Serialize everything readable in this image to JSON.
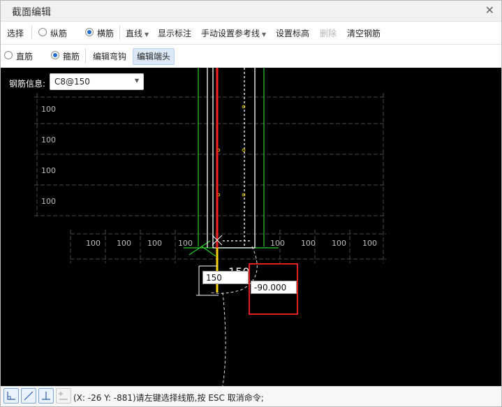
{
  "window": {
    "title": "截面编辑"
  },
  "toolbar1": {
    "select": "选择",
    "longitudinal": "纵筋",
    "transverse": "横筋",
    "line_tool": "直线",
    "show_dimension": "显示标注",
    "manual_reference": "手动设置参考线",
    "set_elevation": "设置标高",
    "delete": "删除",
    "clear_rebar": "清空钢筋"
  },
  "toolbar2": {
    "straight_bar": "直筋",
    "stirrup": "箍筋",
    "edit_hook": "编辑弯钩",
    "edit_end": "编辑端头"
  },
  "canvas": {
    "rebar_info_label": "钢筋信息:",
    "rebar_info_value": "C8@150",
    "grid_label": "100",
    "length_input": "150",
    "angle_input": "-90.000",
    "overlay_text": "150"
  },
  "status": {
    "text": "(X: -26 Y: -881)请左键选择线筋,按 ESC 取消命令;"
  },
  "colors": {
    "accent": "#1f6fd1",
    "highlight_box": "#e01e1e",
    "rebar_red": "#ff2020",
    "rebar_yellow": "#ffd200",
    "rebar_green": "#2bcf2b"
  }
}
